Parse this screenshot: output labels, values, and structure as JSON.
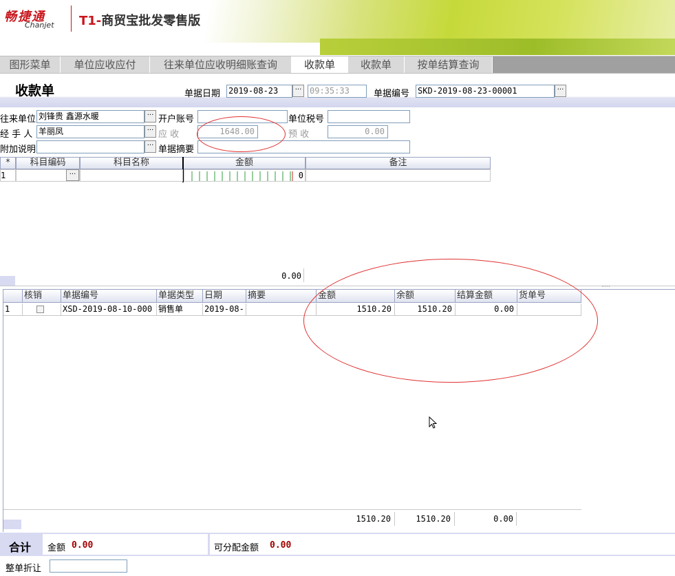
{
  "header": {
    "logo_cn": "畅捷通",
    "logo_en": "Chanjet",
    "product_t1": "T1-",
    "product_name": "商贸宝批发零售版"
  },
  "tabs": [
    {
      "label": "图形菜单"
    },
    {
      "label": "单位应收应付"
    },
    {
      "label": "往来单位应收明细账查询"
    },
    {
      "label": "收款单"
    },
    {
      "label": "收款单"
    },
    {
      "label": "按单结算查询"
    }
  ],
  "form": {
    "title": "收款单",
    "date_label": "单据日期",
    "date_value": "2019-08-23",
    "time_value": "09:35:33",
    "number_label": "单据编号",
    "number_value": "SKD-2019-08-23-00001",
    "partner_label": "往来单位",
    "partner_value": "刘锋贵 鑫源水暖",
    "account_label": "开户账号",
    "account_value": "",
    "tax_label": "单位税号",
    "tax_value": "",
    "handler_label": "经 手 人",
    "handler_value": "羊丽凤",
    "receivable_label": "应  收",
    "receivable_value": "1648.00",
    "prepaid_label": "预  收",
    "prepaid_value": "0.00",
    "note_label": "附加说明",
    "note_value": "",
    "summary_label": "单据摘要",
    "summary_value": ""
  },
  "grid1": {
    "headers": [
      "*",
      "科目编码",
      "科目名称",
      "金额",
      "备注"
    ],
    "row": {
      "index": "1",
      "amount": "0"
    },
    "total": "0.00"
  },
  "grid2": {
    "headers": [
      "核销",
      "单据编号",
      "单据类型",
      "日期",
      "摘要",
      "金额",
      "余额",
      "结算金额",
      "货单号"
    ],
    "rows": [
      {
        "index": "1",
        "checked": false,
        "doc_no": "XSD-2019-08-10-000",
        "doc_type": "销售单",
        "date": "2019-08-",
        "summary": "",
        "amount": "1510.20",
        "balance": "1510.20",
        "settle": "0.00",
        "goods_no": ""
      }
    ],
    "totals": {
      "amount": "1510.20",
      "balance": "1510.20",
      "settle": "0.00"
    }
  },
  "footer": {
    "total_label": "合计",
    "amount_label": "金额",
    "amount_value": "0.00",
    "allocatable_label": "可分配金额",
    "allocatable_value": "0.00",
    "discount_label": "整单折让",
    "discount_value": ""
  }
}
